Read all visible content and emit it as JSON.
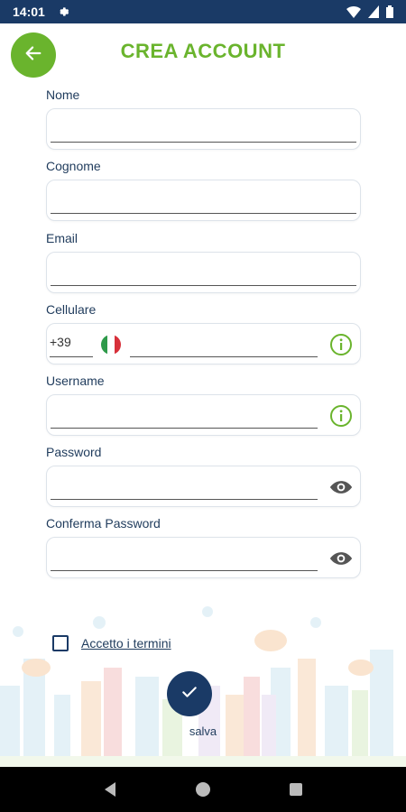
{
  "status_bar": {
    "time": "14:01",
    "icons": [
      "settings-icon",
      "wifi-icon",
      "signal-icon",
      "battery-icon"
    ]
  },
  "header": {
    "title": "CREA ACCOUNT",
    "back_icon": "arrow-left-icon"
  },
  "form": {
    "nome": {
      "label": "Nome",
      "value": ""
    },
    "cognome": {
      "label": "Cognome",
      "value": ""
    },
    "email": {
      "label": "Email",
      "value": ""
    },
    "cellulare": {
      "label": "Cellulare",
      "prefix": "+39",
      "flag": "italy-flag-icon",
      "value": "",
      "info_icon": "info-icon"
    },
    "username": {
      "label": "Username",
      "value": "",
      "info_icon": "info-icon"
    },
    "password": {
      "label": "Password",
      "value": "",
      "toggle_icon": "eye-icon"
    },
    "conferma_password": {
      "label": "Conferma Password",
      "value": "",
      "toggle_icon": "eye-icon"
    }
  },
  "terms": {
    "label": "Accetto i termini",
    "checked": false
  },
  "save": {
    "label": "salva",
    "icon": "check-icon"
  },
  "nav_bar": {
    "icons": [
      "back-triangle-icon",
      "home-circle-icon",
      "recents-square-icon"
    ]
  },
  "colors": {
    "accent_green": "#6ab42d",
    "primary_navy": "#1a3a66",
    "status_bar": "#1a3a66"
  }
}
